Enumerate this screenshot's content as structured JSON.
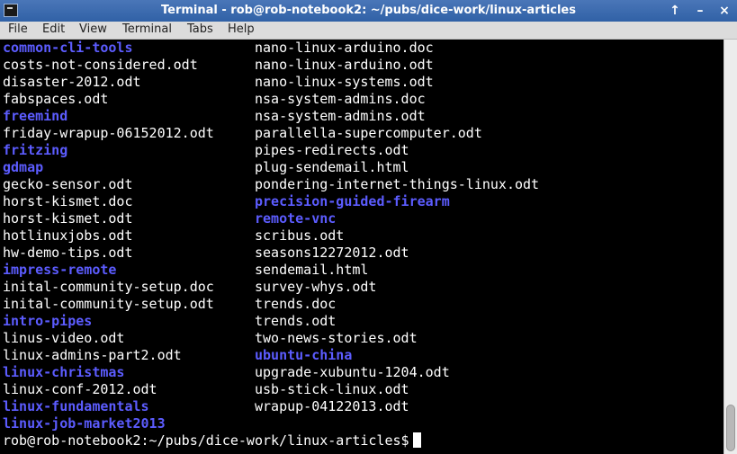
{
  "window": {
    "title": "Terminal - rob@rob-notebook2: ~/pubs/dice-work/linux-articles",
    "controls": [
      "↑",
      "–",
      "×"
    ]
  },
  "menubar": [
    "File",
    "Edit",
    "View",
    "Terminal",
    "Tabs",
    "Help"
  ],
  "colors": {
    "directory": "#5c5cff",
    "file": "#ffffff",
    "background": "#000000"
  },
  "listing": {
    "column1": [
      {
        "name": "common-cli-tools",
        "type": "dir"
      },
      {
        "name": "costs-not-considered.odt",
        "type": "file"
      },
      {
        "name": "disaster-2012.odt",
        "type": "file"
      },
      {
        "name": "fabspaces.odt",
        "type": "file"
      },
      {
        "name": "freemind",
        "type": "dir"
      },
      {
        "name": "friday-wrapup-06152012.odt",
        "type": "file"
      },
      {
        "name": "fritzing",
        "type": "dir"
      },
      {
        "name": "gdmap",
        "type": "dir"
      },
      {
        "name": "gecko-sensor.odt",
        "type": "file"
      },
      {
        "name": "horst-kismet.doc",
        "type": "file"
      },
      {
        "name": "horst-kismet.odt",
        "type": "file"
      },
      {
        "name": "hotlinuxjobs.odt",
        "type": "file"
      },
      {
        "name": "hw-demo-tips.odt",
        "type": "file"
      },
      {
        "name": "impress-remote",
        "type": "dir"
      },
      {
        "name": "inital-community-setup.doc",
        "type": "file"
      },
      {
        "name": "inital-community-setup.odt",
        "type": "file"
      },
      {
        "name": "intro-pipes",
        "type": "dir"
      },
      {
        "name": "linus-video.odt",
        "type": "file"
      },
      {
        "name": "linux-admins-part2.odt",
        "type": "file"
      },
      {
        "name": "linux-christmas",
        "type": "dir"
      },
      {
        "name": "linux-conf-2012.odt",
        "type": "file"
      },
      {
        "name": "linux-fundamentals",
        "type": "dir"
      },
      {
        "name": "linux-job-market2013",
        "type": "dir"
      }
    ],
    "column2": [
      {
        "name": "nano-linux-arduino.doc",
        "type": "file"
      },
      {
        "name": "nano-linux-arduino.odt",
        "type": "file"
      },
      {
        "name": "nano-linux-systems.odt",
        "type": "file"
      },
      {
        "name": "nsa-system-admins.doc",
        "type": "file"
      },
      {
        "name": "nsa-system-admins.odt",
        "type": "file"
      },
      {
        "name": "parallella-supercomputer.odt",
        "type": "file"
      },
      {
        "name": "pipes-redirects.odt",
        "type": "file"
      },
      {
        "name": "plug-sendemail.html",
        "type": "file"
      },
      {
        "name": "pondering-internet-things-linux.odt",
        "type": "file"
      },
      {
        "name": "precision-guided-firearm",
        "type": "dir"
      },
      {
        "name": "remote-vnc",
        "type": "dir"
      },
      {
        "name": "scribus.odt",
        "type": "file"
      },
      {
        "name": "seasons12272012.odt",
        "type": "file"
      },
      {
        "name": "sendemail.html",
        "type": "file"
      },
      {
        "name": "survey-whys.odt",
        "type": "file"
      },
      {
        "name": "trends.doc",
        "type": "file"
      },
      {
        "name": "trends.odt",
        "type": "file"
      },
      {
        "name": "two-news-stories.odt",
        "type": "file"
      },
      {
        "name": "ubuntu-china",
        "type": "dir"
      },
      {
        "name": "upgrade-xubuntu-1204.odt",
        "type": "file"
      },
      {
        "name": "usb-stick-linux.odt",
        "type": "file"
      },
      {
        "name": "wrapup-04122013.odt",
        "type": "file"
      }
    ]
  },
  "prompt": "rob@rob-notebook2:~/pubs/dice-work/linux-articles$"
}
